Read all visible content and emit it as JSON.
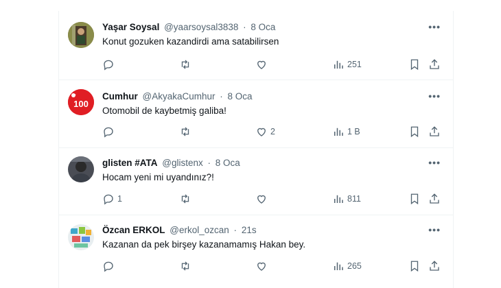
{
  "tweets": [
    {
      "name": "Yaşar Soysal",
      "handle": "@yaarsoysal3838",
      "sep": "·",
      "time": "8 Oca",
      "text": "Konut  gozuken kazandirdi ama satabilirsen",
      "replies": "",
      "reposts": "",
      "likes": "",
      "views": "251",
      "more": "•••"
    },
    {
      "name": "Cumhur",
      "handle": "@AkyakaCumhur",
      "sep": "·",
      "time": "8 Oca",
      "text": "Otomobil de kaybetmiş galiba!",
      "replies": "",
      "reposts": "",
      "likes": "2",
      "views": "1 B",
      "more": "•••",
      "avatar_label": "100"
    },
    {
      "name": "glisten #ATA",
      "handle": "@glistenx",
      "sep": "·",
      "time": "8 Oca",
      "text": "Hocam yeni mi uyandınız?!",
      "replies": "1",
      "reposts": "",
      "likes": "",
      "views": "811",
      "more": "•••"
    },
    {
      "name": "Özcan ERKOL",
      "handle": "@erkol_ozcan",
      "sep": "·",
      "time": "21s",
      "text": "Kazanan da pek birşey kazanamamış Hakan bey.",
      "replies": "",
      "reposts": "",
      "likes": "",
      "views": "265",
      "more": "•••"
    }
  ],
  "icons": {
    "reply": "reply-icon",
    "repost": "repost-icon",
    "like": "like-icon",
    "views": "views-icon",
    "bookmark": "bookmark-icon",
    "share": "share-icon"
  },
  "colors": {
    "text": "#0f1419",
    "muted": "#536471",
    "border": "#eff3f4"
  }
}
